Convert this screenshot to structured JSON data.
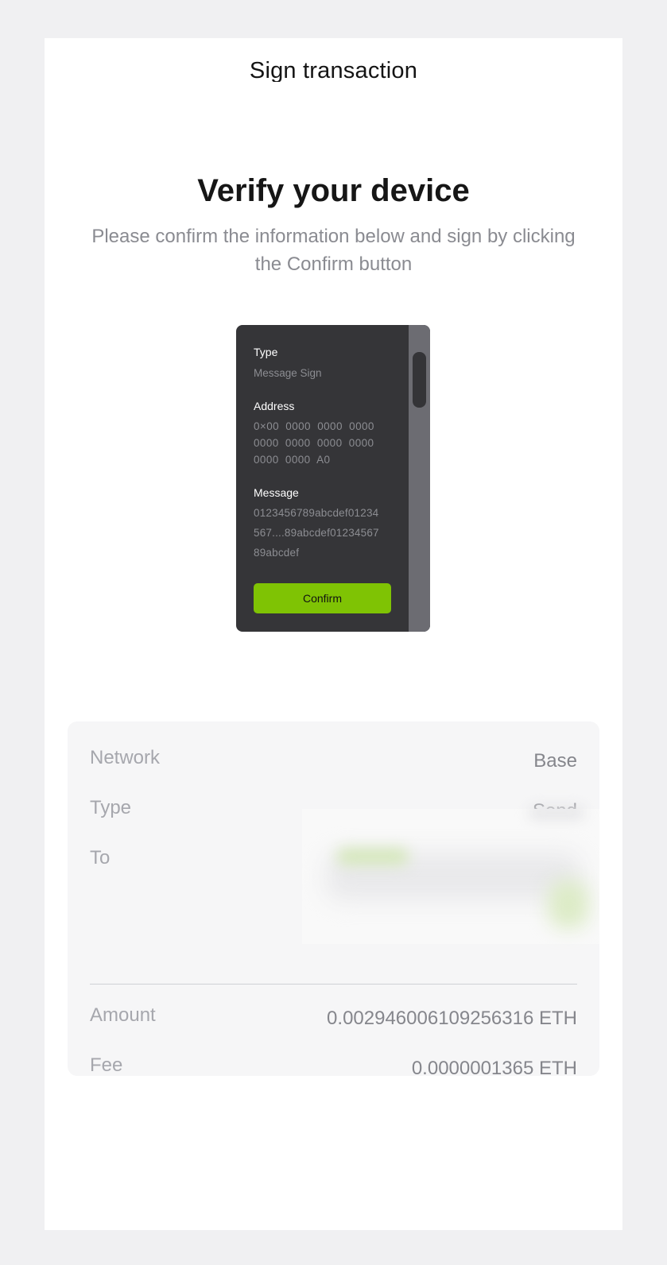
{
  "header": {
    "title": "Sign transaction"
  },
  "verify": {
    "heading": "Verify your device",
    "subtitle": "Please confirm the information below and sign by clicking the Confirm button"
  },
  "device": {
    "type_label": "Type",
    "type_value": "Message Sign",
    "address_label": "Address",
    "address_lines": [
      "0×00  0000  0000  0000",
      "0000  0000  0000  0000",
      "0000  0000  A0"
    ],
    "message_label": "Message",
    "message_lines": [
      "0123456789abcdef01234",
      "567....89abcdef01234567",
      "89abcdef"
    ],
    "confirm_label": "Confirm"
  },
  "summary": {
    "network_label": "Network",
    "network_value": "Base",
    "type_label": "Type",
    "type_value": "Send",
    "to_label": "To",
    "amount_label": "Amount",
    "amount_value": "0.002946006109256316 ETH",
    "fee_label": "Fee",
    "fee_value": "0.0000001365 ETH"
  },
  "colors": {
    "accent": "#7fc304",
    "device_bg": "#353538",
    "page_bg": "#f0f0f2"
  }
}
